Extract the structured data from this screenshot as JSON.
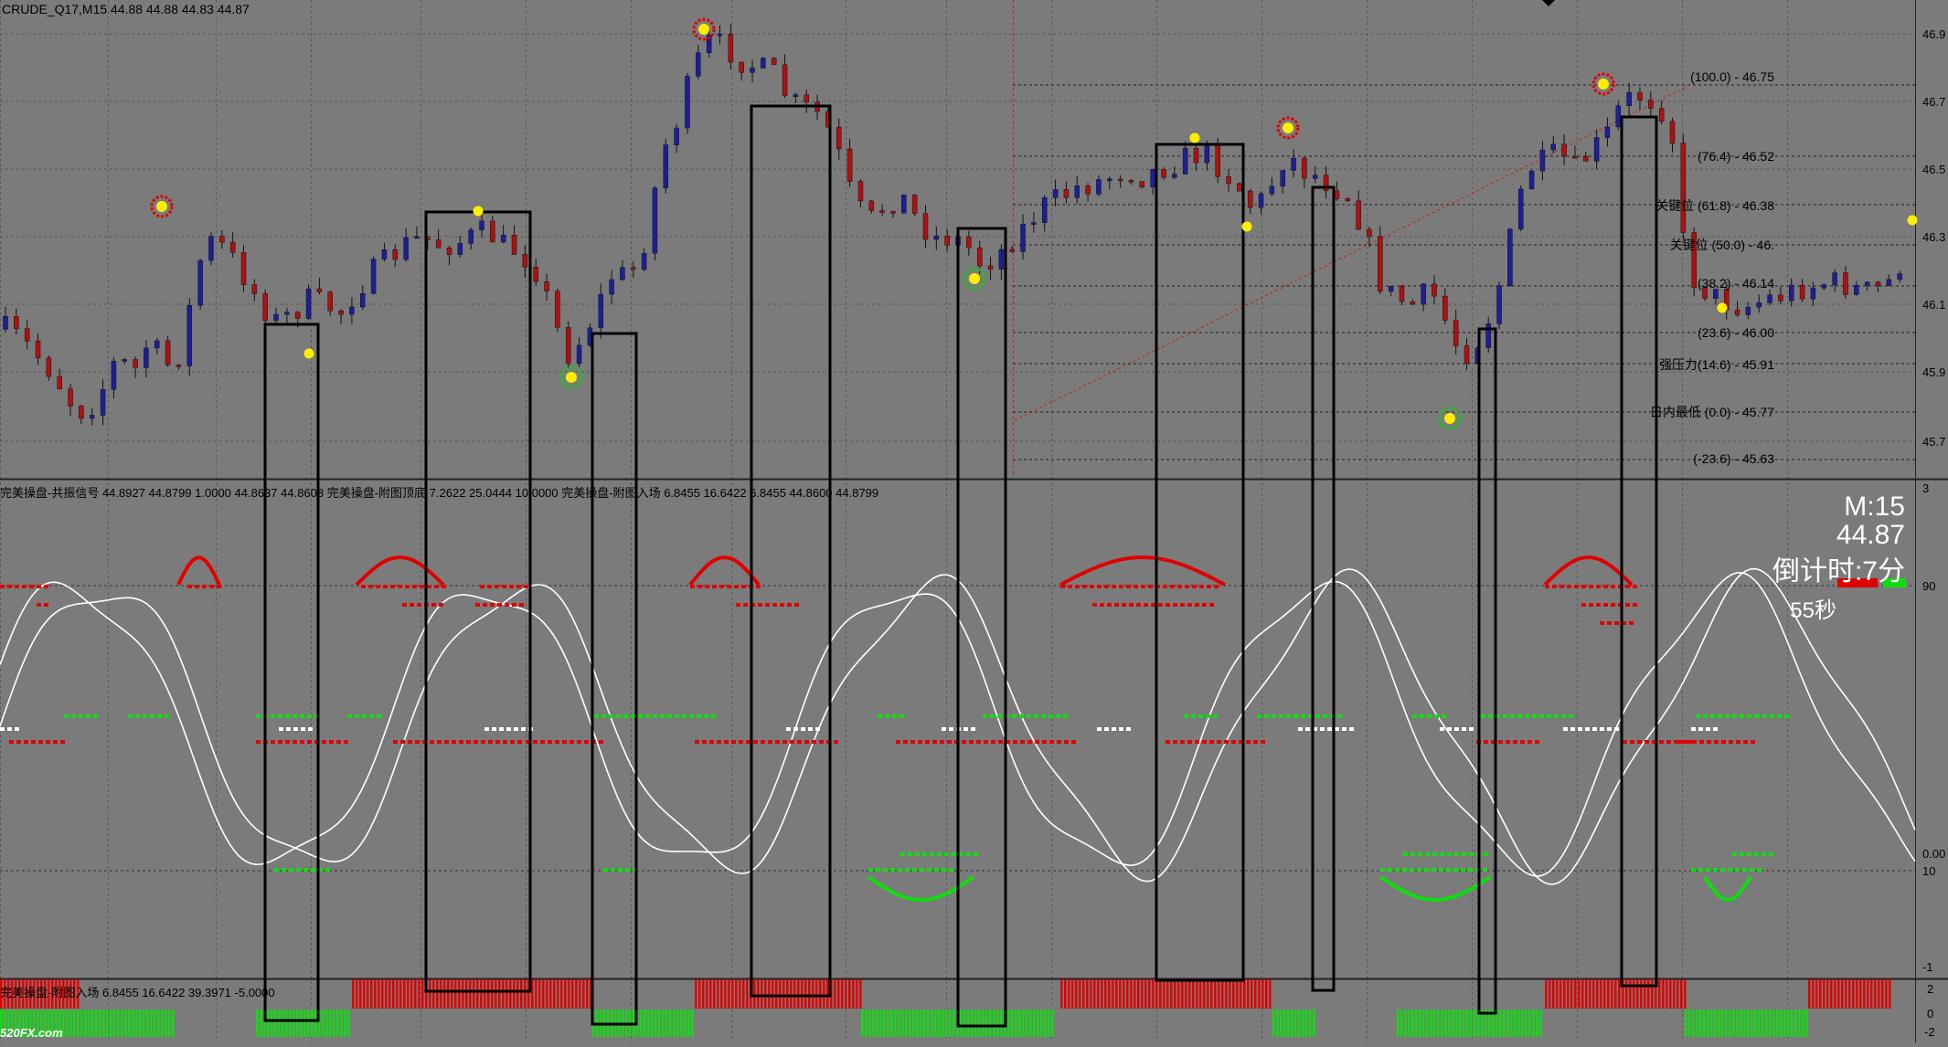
{
  "colors": {
    "bg": "#7b7b7b",
    "bull": "#1e1e9a",
    "bear": "#b01010",
    "red": "#e00000",
    "green": "#10dd10",
    "white": "#ffffff",
    "box": "#000000",
    "signal": "#ffee00"
  },
  "header": {
    "symbol_text": "CRUDE_Q17,M15  44.88 44.88 44.83 44.87"
  },
  "panel2": {
    "header_text": "完美操盘-共振信号 44.8927 44.8799 1.0000 44.8637 44.8608  完美操盘-附图顶底 7.2622 25.0444 10.0000  完美操盘-附图入场 6.8455 16.6422 6.8455 44.8600 44.8799"
  },
  "panel3": {
    "header_text": "完美操盘-附图入场 6.8455 16.6422 39.3971 -5.0000"
  },
  "info": {
    "period": "M:15",
    "price": "44.87",
    "countdown": "倒计时:7分",
    "seconds": "55秒"
  },
  "watermark": "520FX.com",
  "fib_labels": [
    "(100.0) - 46.75",
    "(76.4) - 46.52",
    "关键位 (61.8) - 46.38",
    "关键位 (50.0) - 46.",
    "(38.2) - 46.14",
    "(23.6) - 46.00",
    "强压力(14.6) - 45.91",
    "日内最低 (0.0) - 45.77",
    "(-23.6) - 45.63"
  ],
  "price_axis": [
    "46.9",
    "46.7",
    "46.5",
    "46.3",
    "46.1",
    "45.9",
    "45.7"
  ],
  "osc_axis": [
    "3",
    "90",
    "0.00",
    "10",
    "-1"
  ],
  "bar_axis": [
    "2",
    "0",
    "-2"
  ],
  "close_path": [
    46.03,
    46.0,
    45.95,
    45.9,
    45.82,
    45.78,
    45.85,
    45.95,
    45.9,
    46.0,
    45.92,
    45.96,
    46.22,
    46.3,
    46.25,
    46.18,
    46.1,
    46.05,
    46.08,
    46.12,
    46.1,
    46.08,
    46.15,
    46.2,
    46.24,
    46.28,
    46.3,
    46.28,
    46.28,
    46.3,
    46.32,
    46.28,
    46.26,
    46.22,
    46.1,
    45.95,
    46.0,
    46.1,
    46.2,
    46.18,
    46.3,
    46.55,
    46.65,
    46.8,
    46.88,
    46.86,
    46.82,
    46.8,
    46.78,
    46.7,
    46.68,
    46.66,
    46.55,
    46.4,
    46.35,
    46.4,
    46.42,
    46.35,
    46.3,
    46.3,
    46.28,
    46.22,
    46.25,
    46.3,
    46.35,
    46.4,
    46.42,
    46.45,
    46.46,
    46.48,
    46.5,
    46.48,
    46.5,
    46.52,
    46.54,
    46.55,
    46.5,
    46.45,
    46.38,
    46.45,
    46.55,
    46.5,
    46.48,
    46.45,
    46.42,
    46.3,
    46.15,
    46.12,
    46.1,
    46.15,
    46.05,
    45.95,
    46.0,
    46.1,
    46.3,
    46.5,
    46.52,
    46.55,
    46.5,
    46.55,
    46.6,
    46.7,
    46.72,
    46.7,
    46.65,
    46.2,
    46.15,
    46.12,
    46.1,
    46.1,
    46.12,
    46.13,
    46.15,
    46.16,
    46.17,
    46.16,
    46.14,
    46.15,
    46.18,
    46.3
  ]
}
